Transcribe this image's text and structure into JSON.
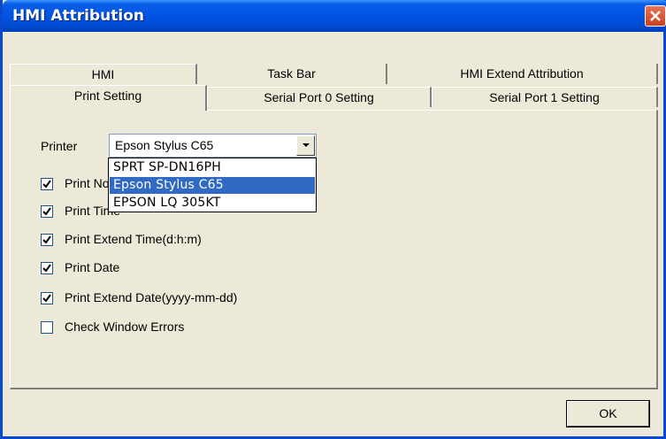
{
  "window": {
    "title": "HMI Attribution"
  },
  "tabs": {
    "row1": [
      "HMI",
      "Task Bar",
      "HMI Extend Attribution"
    ],
    "row2": [
      "Print Setting",
      "Serial Port 0 Setting",
      "Serial Port 1 Setting"
    ],
    "active": "Print Setting"
  },
  "printer": {
    "label": "Printer",
    "selected": "Epson Stylus C65",
    "options": [
      "SPRT SP-DN16PH",
      "Epson Stylus C65",
      "EPSON LQ 305KT"
    ]
  },
  "checkboxes": [
    {
      "label": "Print No",
      "checked": true
    },
    {
      "label": "Print Time",
      "checked": true
    },
    {
      "label": "Print Extend Time(d:h:m)",
      "checked": true
    },
    {
      "label": "Print Date",
      "checked": true
    },
    {
      "label": "Print Extend Date(yyyy-mm-dd)",
      "checked": true
    },
    {
      "label": "Check Window Errors",
      "checked": false
    }
  ],
  "buttons": {
    "ok": "OK"
  },
  "colors": {
    "titlebar": "#0054E3",
    "selection": "#316AC5",
    "face": "#ECE9D8"
  }
}
